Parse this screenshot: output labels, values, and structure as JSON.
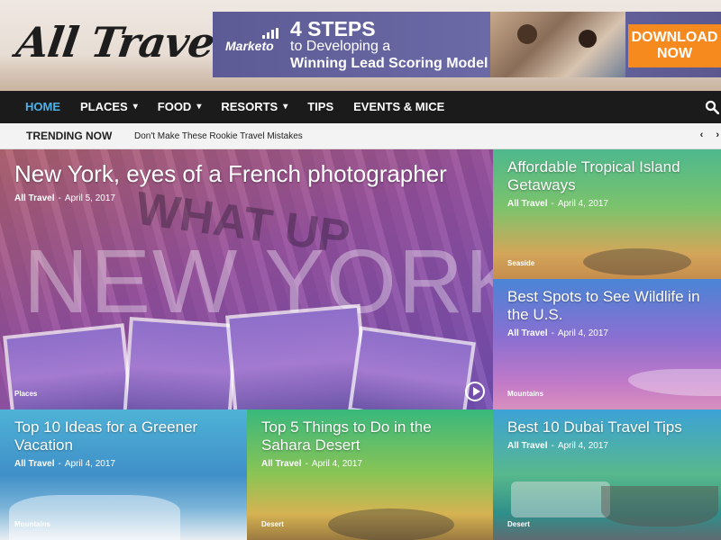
{
  "site": {
    "logo_text": "All Travel"
  },
  "ad": {
    "brand": "Marketo",
    "line1": "4 STEPS",
    "line2": "to Developing a",
    "line3": "Winning Lead Scoring Model",
    "cta_line1": "DOWNLOAD",
    "cta_line2": "NOW"
  },
  "nav": {
    "items": [
      {
        "label": "HOME",
        "active": true,
        "has_dropdown": false
      },
      {
        "label": "PLACES",
        "active": false,
        "has_dropdown": true
      },
      {
        "label": "FOOD",
        "active": false,
        "has_dropdown": true
      },
      {
        "label": "RESORTS",
        "active": false,
        "has_dropdown": true
      },
      {
        "label": "TIPS",
        "active": false,
        "has_dropdown": false
      },
      {
        "label": "EVENTS & MICE",
        "active": false,
        "has_dropdown": false
      }
    ],
    "search_icon": "search-icon",
    "active_color": "#4db2ec"
  },
  "trending": {
    "label": "TRENDING NOW",
    "headline": "Don't Make These Rookie Travel Mistakes",
    "prev": "‹",
    "next": "›"
  },
  "posts": {
    "main": {
      "title": "New York, eyes of a French photographer",
      "author": "All Travel",
      "date": "April 5, 2017",
      "category": "Places",
      "image_text_1": "NEW YORK",
      "image_text_2": "WHAT UP"
    },
    "right1": {
      "title": "Affordable Tropical Island Getaways",
      "author": "All Travel",
      "date": "April 4, 2017",
      "category": "Seaside"
    },
    "right2": {
      "title": "Best Spots to See Wildlife in the U.S.",
      "author": "All Travel",
      "date": "April 4, 2017",
      "category": "Mountains"
    },
    "bottom1": {
      "title": "Top 10 Ideas for a Greener Vacation",
      "author": "All Travel",
      "date": "April 4, 2017",
      "category": "Mountains"
    },
    "bottom2": {
      "title": "Top 5 Things to Do in the Sahara Desert",
      "author": "All Travel",
      "date": "April 4, 2017",
      "category": "Desert"
    },
    "bottom3": {
      "title": "Best 10 Dubai Travel Tips",
      "author": "All Travel",
      "date": "April 4, 2017",
      "category": "Desert"
    }
  },
  "meta_separator": "-"
}
